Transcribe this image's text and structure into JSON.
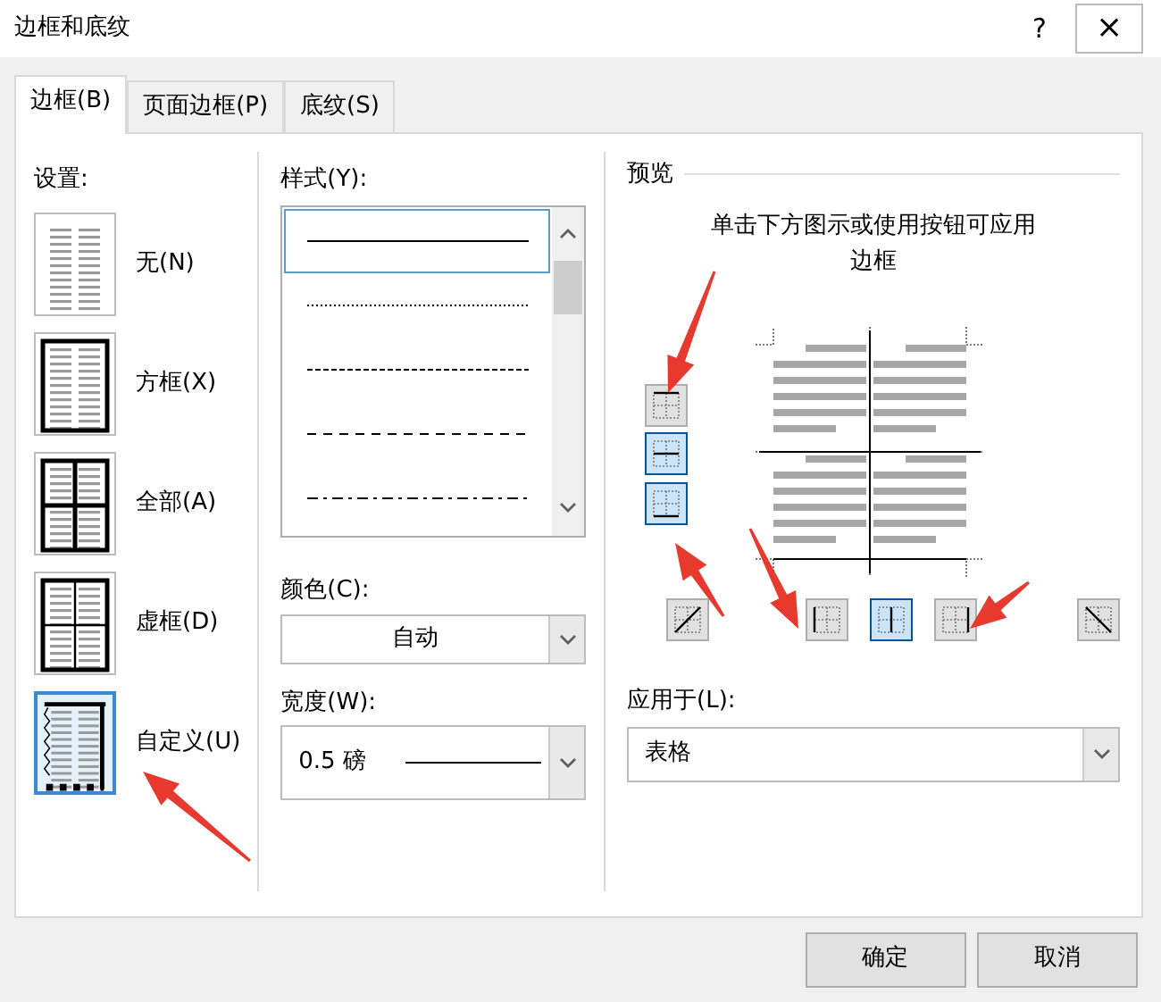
{
  "window": {
    "title": "边框和底纹",
    "help": "?",
    "close": "×"
  },
  "tabs": [
    {
      "label": "边框(B)",
      "selected": true
    },
    {
      "label": "页面边框(P)",
      "selected": false
    },
    {
      "label": "底纹(S)",
      "selected": false
    }
  ],
  "settings": {
    "label": "设置:",
    "items": [
      {
        "label": "无(N)",
        "kind": "none",
        "selected": false
      },
      {
        "label": "方框(X)",
        "kind": "box",
        "selected": false
      },
      {
        "label": "全部(A)",
        "kind": "all",
        "selected": false
      },
      {
        "label": "虚框(D)",
        "kind": "grid",
        "selected": false
      },
      {
        "label": "自定义(U)",
        "kind": "custom",
        "selected": true
      }
    ]
  },
  "style": {
    "label": "样式(Y):",
    "options": [
      {
        "kind": "solid",
        "selected": true
      },
      {
        "kind": "dotted",
        "selected": false
      },
      {
        "kind": "fine-dashed",
        "selected": false
      },
      {
        "kind": "dashed",
        "selected": false
      },
      {
        "kind": "dash-dot",
        "selected": false
      }
    ]
  },
  "color": {
    "label": "颜色(C):",
    "value": "自动"
  },
  "width": {
    "label": "宽度(W):",
    "value": "0.5 磅"
  },
  "preview": {
    "label": "预览",
    "hint": "单击下方图示或使用按钮可应用边框",
    "side_buttons": [
      {
        "kind": "top",
        "pressed": false
      },
      {
        "kind": "inside-horizontal",
        "pressed": true
      },
      {
        "kind": "bottom",
        "pressed": true
      }
    ],
    "bottom_buttons": [
      {
        "kind": "diagonal-up",
        "pressed": false
      },
      {
        "kind": "left",
        "pressed": false
      },
      {
        "kind": "inside-vertical",
        "pressed": true
      },
      {
        "kind": "right",
        "pressed": false
      },
      {
        "kind": "diagonal-down",
        "pressed": false
      }
    ]
  },
  "apply_to": {
    "label": "应用于(L):",
    "value": "表格"
  },
  "buttons": [
    "确定",
    "取消"
  ],
  "annotations": [
    {
      "kind": "arrow"
    },
    {
      "kind": "arrow"
    },
    {
      "kind": "arrow"
    },
    {
      "kind": "arrow"
    },
    {
      "kind": "arrow"
    }
  ]
}
